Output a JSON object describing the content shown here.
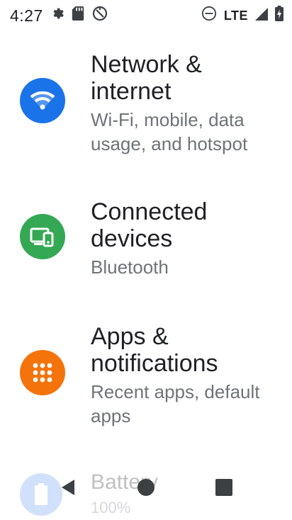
{
  "status_bar": {
    "time": "4:27",
    "network_label": "LTE",
    "icons": [
      "settings-gear-icon",
      "sd-card-icon",
      "sync-icon",
      "do-not-disturb-icon",
      "signal-icon",
      "battery-icon"
    ]
  },
  "settings": [
    {
      "title_line1": "Network &",
      "title_line2": "internet",
      "subtitle_line1": "Wi-Fi, mobile, data",
      "subtitle_line2": "usage, and hotspot",
      "icon": "wifi-icon",
      "color": "#1a73e8"
    },
    {
      "title_line1": "Connected",
      "title_line2": "devices",
      "subtitle_line1": "Bluetooth",
      "icon": "devices-icon",
      "color": "#34a853"
    },
    {
      "title_line1": "Apps &",
      "title_line2": "notifications",
      "subtitle_line1": "Recent apps, default",
      "subtitle_line2": "apps",
      "icon": "apps-grid-icon",
      "color": "#f4730b"
    },
    {
      "title_line1": "Battery",
      "subtitle_line1": "100%",
      "icon": "battery-icon",
      "color": "#5e97f6"
    }
  ],
  "nav": {
    "back": "back-icon",
    "home": "home-icon",
    "recents": "recents-icon"
  }
}
